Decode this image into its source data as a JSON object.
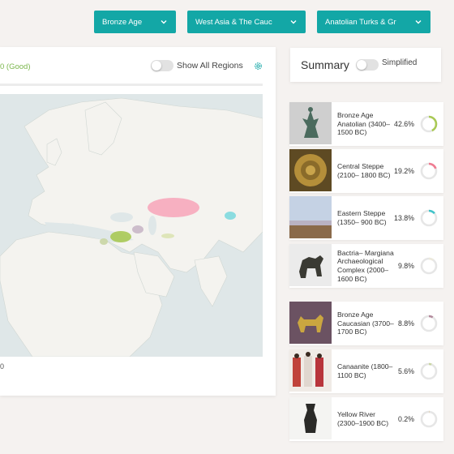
{
  "filters": {
    "period": "Bronze Age",
    "region": "West Asia & The Cauc",
    "population": "Anatolian Turks & Gr"
  },
  "map_panel": {
    "score_text": "0 (Good)",
    "show_all_label": "Show All Regions",
    "scale_text": "0"
  },
  "summary": {
    "title": "Summary",
    "simplified_label": "Simplified"
  },
  "icons": {
    "dropdown": "chevron-down-icon",
    "settings": "gear-icon"
  },
  "colors": {
    "accent": "#13a7a6",
    "good": "#7bb74d",
    "ring_track": "#e6e6e6"
  },
  "populations": [
    {
      "name": "Bronze Age Anatolian (3400–1500 BC)",
      "percent": "42.6%",
      "fraction": 0.426,
      "color": "#a9c954",
      "thumb": "statue-image"
    },
    {
      "name": "Central Steppe (2100– 1800 BC)",
      "percent": "19.2%",
      "fraction": 0.192,
      "color": "#ef7c92",
      "thumb": "gold-plate-image"
    },
    {
      "name": "Eastern Steppe (1350– 900 BC)",
      "percent": "13.8%",
      "fraction": 0.138,
      "color": "#3fc3c9",
      "thumb": "steppe-landscape-image"
    },
    {
      "name": "Bactria– Margiana Archaeological Complex (2000–1600 BC)",
      "percent": "9.8%",
      "fraction": 0.098,
      "color": "#ece9dc",
      "thumb": "camel-statue-image"
    },
    {
      "name": "Bronze Age Caucasian (3700–1700 BC)",
      "percent": "8.8%",
      "fraction": 0.088,
      "color": "#b38a9c",
      "thumb": "golden-bull-image"
    },
    {
      "name": "Canaanite (1800–1100 BC)",
      "percent": "5.6%",
      "fraction": 0.056,
      "color": "#c9d5a3",
      "thumb": "figures-painting-image"
    },
    {
      "name": "Yellow River (2300–1900 BC)",
      "percent": "0.2%",
      "fraction": 0.002,
      "color": "#e0c9a0",
      "thumb": "pottery-vessel-image"
    }
  ]
}
